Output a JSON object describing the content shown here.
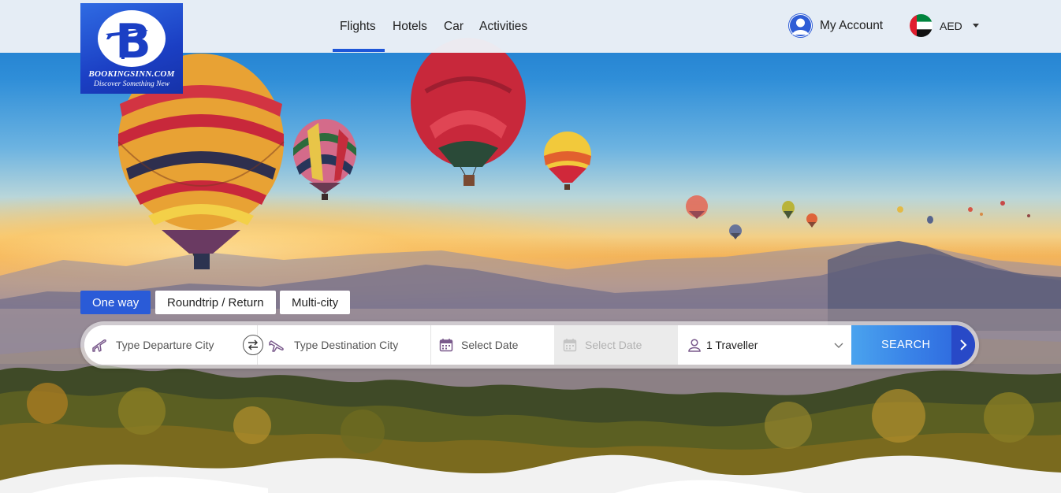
{
  "brand": {
    "name": "BOOKINGSINN.COM",
    "tagline": "Discover Something New"
  },
  "nav": {
    "items": [
      "Flights",
      "Hotels",
      "Car",
      "Activities"
    ],
    "active": "Flights"
  },
  "account": {
    "label": "My Account"
  },
  "currency": {
    "code": "AED",
    "flag": "uae-flag"
  },
  "trip_types": {
    "items": [
      "One way",
      "Roundtrip / Return",
      "Multi-city"
    ],
    "active": "One way"
  },
  "search": {
    "departure_placeholder": "Type Departure City",
    "destination_placeholder": "Type Destination City",
    "depart_date_placeholder": "Select Date",
    "return_date_placeholder": "Select Date",
    "travellers": "1 Traveller",
    "button_label": "SEARCH"
  },
  "colors": {
    "accent": "#2a5bd7",
    "nav_underline": "#1e56d8",
    "search_button_start": "#4aa3ee",
    "search_button_end": "#2b62dc",
    "icon_purple": "#7a5a8c"
  }
}
